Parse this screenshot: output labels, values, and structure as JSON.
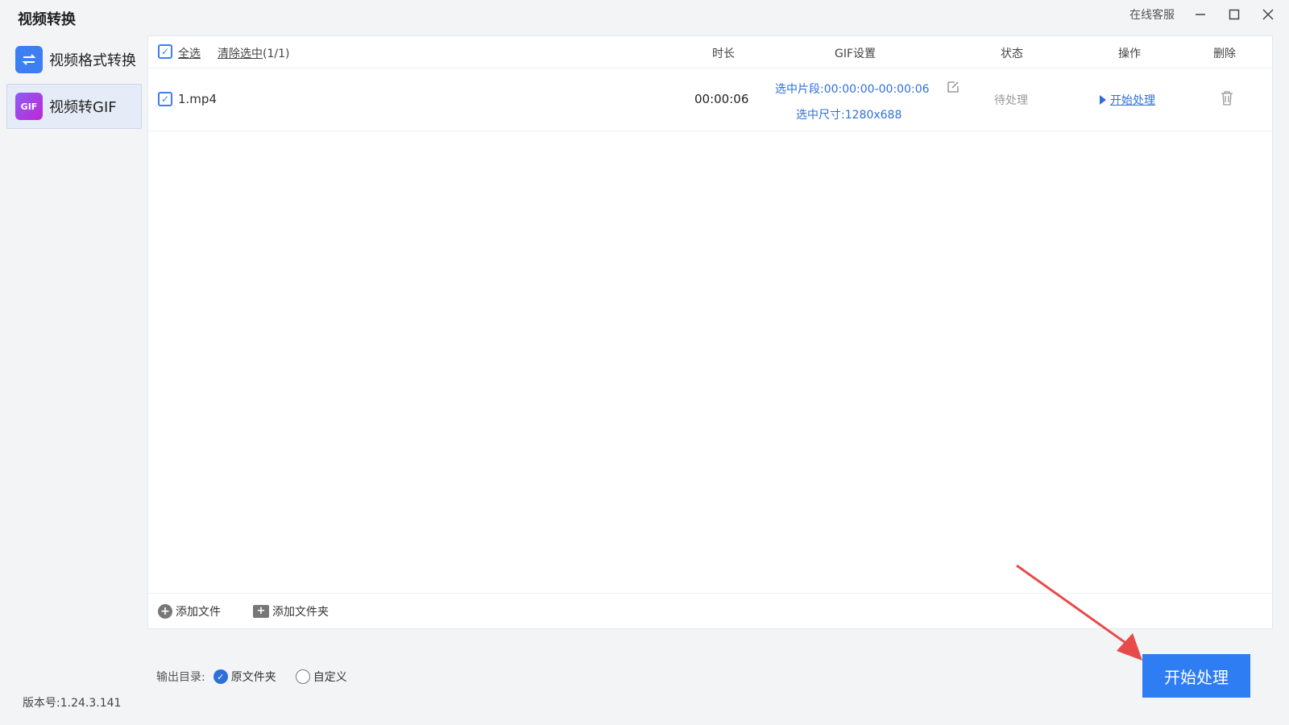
{
  "window": {
    "title": "视频转换",
    "support_label": "在线客服"
  },
  "sidebar": {
    "items": [
      {
        "label": "视频格式转换",
        "icon": "swap-arrows-icon"
      },
      {
        "label": "视频转GIF",
        "icon": "gif-icon",
        "icon_text": "GIF"
      }
    ]
  },
  "table": {
    "select_all_label": "全选",
    "clear_selection_label": "清除选中",
    "selection_count": "(1/1)",
    "headers": {
      "duration": "时长",
      "gif_settings": "GIF设置",
      "status": "状态",
      "action": "操作",
      "delete": "删除"
    },
    "rows": [
      {
        "filename": "1.mp4",
        "duration": "00:00:06",
        "segment": "选中片段:00:00:00-00:00:06",
        "size": "选中尺寸:1280x688",
        "status": "待处理",
        "action_label": "开始处理"
      }
    ],
    "add_file_label": "添加文件",
    "add_folder_label": "添加文件夹"
  },
  "output": {
    "label": "输出目录:",
    "option_original": "原文件夹",
    "option_custom": "自定义"
  },
  "start_button_label": "开始处理",
  "version": "版本号:1.24.3.141",
  "colors": {
    "accent": "#2f7df3",
    "link": "#2f6fdc",
    "annotation_arrow": "#e84a4a"
  }
}
